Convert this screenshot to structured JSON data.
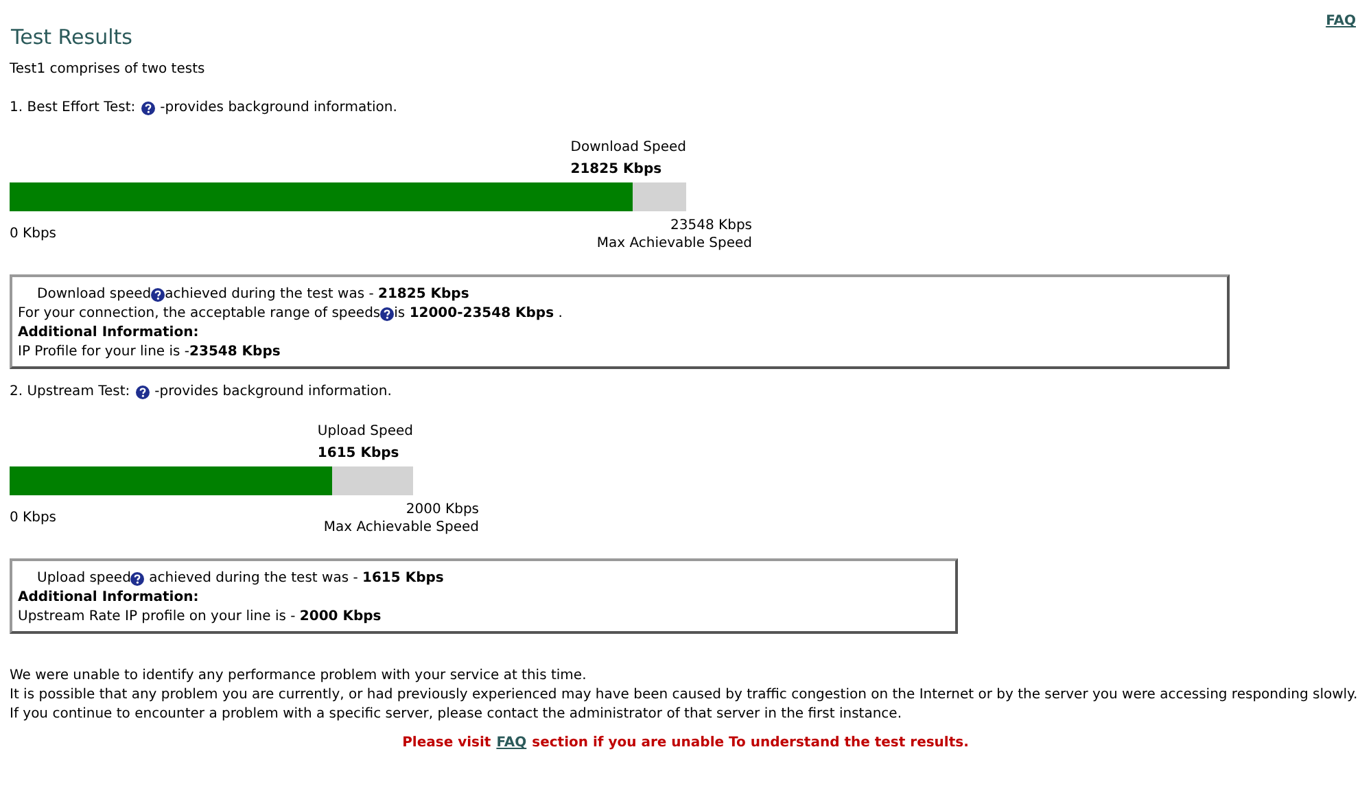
{
  "title": "Test Results",
  "faq_link": "FAQ",
  "intro": "Test1 comprises of two tests",
  "tests": [
    {
      "heading": "1. Best Effort Test:",
      "description": "-provides background information.",
      "meter": {
        "label": "Download Speed",
        "value": "21825 Kbps",
        "level": 0.92,
        "min_label": "0 Kbps",
        "max_value": "23548 Kbps",
        "max_label": "Max Achievable Speed"
      },
      "info": [
        {
          "kind": "line",
          "before": "Download speed",
          "help_icon": true,
          "after": "achieved during the test was - **21825 Kbps**",
          "indent": true
        },
        {
          "kind": "line",
          "before": "For your connection, the acceptable range of speeds",
          "help_icon": true,
          "after": "is **12000-23548 Kbps** .",
          "indent": false
        },
        {
          "kind": "heading",
          "before": "Additional Information:"
        },
        {
          "kind": "line",
          "before": "IP Profile for your line is -**23548 Kbps**",
          "help_icon": false,
          "indent": false
        }
      ]
    },
    {
      "heading": "2. Upstream Test:",
      "description": "-provides background information.",
      "meter": {
        "label": "Upload Speed",
        "value": "1615 Kbps",
        "level": 0.8,
        "min_label": "0 Kbps",
        "max_value": "2000 Kbps",
        "max_label": "Max Achievable Speed"
      },
      "info": [
        {
          "kind": "line",
          "before": "Upload speed",
          "help_icon": true,
          "after": " achieved during the test was - **1615 Kbps**",
          "indent": true
        },
        {
          "kind": "heading",
          "before": "Additional Information:"
        },
        {
          "kind": "line",
          "before": "Upstream Rate IP profile on your line is - **2000 Kbps**",
          "help_icon": false,
          "indent": false
        }
      ]
    }
  ],
  "summary": [
    "We were unable to identify any performance problem with your service at this time.",
    "It is possible that any problem you are currently, or had previously experienced may have been caused by traffic congestion on the Internet or by the server you were accessing responding slowly.",
    "If you continue to encounter a problem with a specific server, please contact the administrator of that server in the first instance."
  ],
  "notice": {
    "before": "Please visit",
    "link": "FAQ",
    "after": "section if you are unable To understand the test results."
  }
}
